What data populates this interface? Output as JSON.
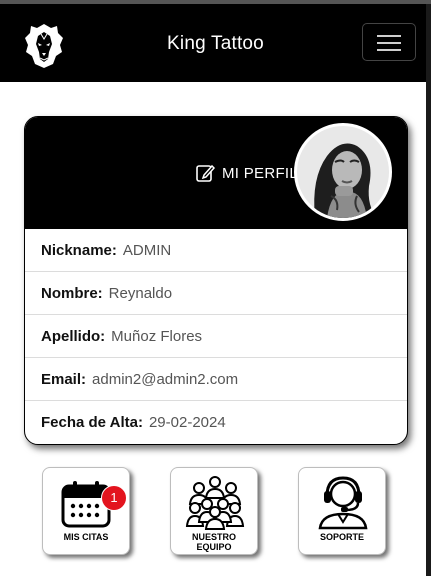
{
  "navbar": {
    "brand": "King Tattoo",
    "logo_icon": "lion-head-icon",
    "menu_icon": "hamburger-menu-icon",
    "background": "#000000"
  },
  "profile": {
    "edit_label": "MI PERFIL",
    "edit_icon": "edit-pencil-icon",
    "fields": [
      {
        "label": "Nickname:",
        "value": "ADMIN"
      },
      {
        "label": "Nombre:",
        "value": "Reynaldo"
      },
      {
        "label": "Apellido:",
        "value": "Muñoz Flores"
      },
      {
        "label": "Email:",
        "value": "admin2@admin2.com"
      },
      {
        "label": "Fecha de Alta:",
        "value": "29-02-2024"
      }
    ]
  },
  "tiles": {
    "citas": {
      "line1": "MIS CITAS",
      "badge": "1",
      "icon": "calendar-icon"
    },
    "equipo": {
      "line1": "NUESTRO",
      "line2": "EQUIPO",
      "icon": "team-icon"
    },
    "soporte": {
      "line1": "SOPORTE",
      "icon": "support-headset-icon"
    }
  },
  "colors": {
    "accent": "#000000",
    "badge": "#e3141e"
  }
}
